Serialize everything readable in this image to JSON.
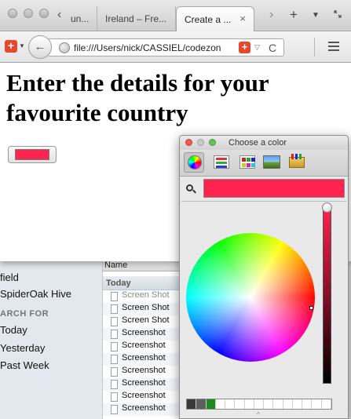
{
  "browser": {
    "tabs": [
      {
        "label": "un..."
      },
      {
        "label": "Ireland – Fre..."
      },
      {
        "label": "Create a ...",
        "close": "×"
      }
    ],
    "new_tab_symbol": "+",
    "tab_list_symbol": "▼",
    "scroll_left_symbol": "‹",
    "scroll_right_symbol": "›",
    "back_symbol": "←",
    "url": "file:///Users/nick/CASSIEL/codezon",
    "addon_symbol": "+",
    "url_dropdown_symbol": "▽",
    "reload_symbol": "C"
  },
  "page": {
    "title": "Enter the details for your favourite country",
    "color_value": "#ff2350"
  },
  "color_picker": {
    "title": "Choose a color",
    "modes": [
      "color-wheel",
      "color-sliders",
      "color-palettes",
      "image-palettes",
      "crayons"
    ],
    "selected_mode": "color-wheel",
    "current_color": "#ff2350",
    "brightness": 1.0,
    "swatches": [
      "#3a3a3a",
      "#5f5f5f",
      "#1e8a1e",
      "#ffffff",
      "#ffffff",
      "#ffffff",
      "#ffffff",
      "#ffffff",
      "#ffffff",
      "#ffffff",
      "#ffffff",
      "#ffffff",
      "#ffffff",
      "#ffffff",
      "#ffffff"
    ],
    "grip_symbol": "^"
  },
  "finder": {
    "sidebar_items": [
      {
        "label": "field"
      },
      {
        "label": "SpiderOak Hive"
      }
    ],
    "section_label": "ARCH FOR",
    "search_items": [
      {
        "label": "Today"
      },
      {
        "label": "Yesterday"
      },
      {
        "label": "Past Week"
      }
    ],
    "column_header": "Name",
    "group_header": "Today",
    "rows": [
      {
        "name": "Screen Shot"
      },
      {
        "name": "Screen Shot"
      },
      {
        "name": "Screen Shot"
      },
      {
        "name": "Screenshot"
      },
      {
        "name": "Screenshot"
      },
      {
        "name": "Screenshot"
      },
      {
        "name": "Screenshot"
      },
      {
        "name": "Screenshot"
      },
      {
        "name": "Screenshot"
      },
      {
        "name": "Screenshot"
      }
    ]
  }
}
